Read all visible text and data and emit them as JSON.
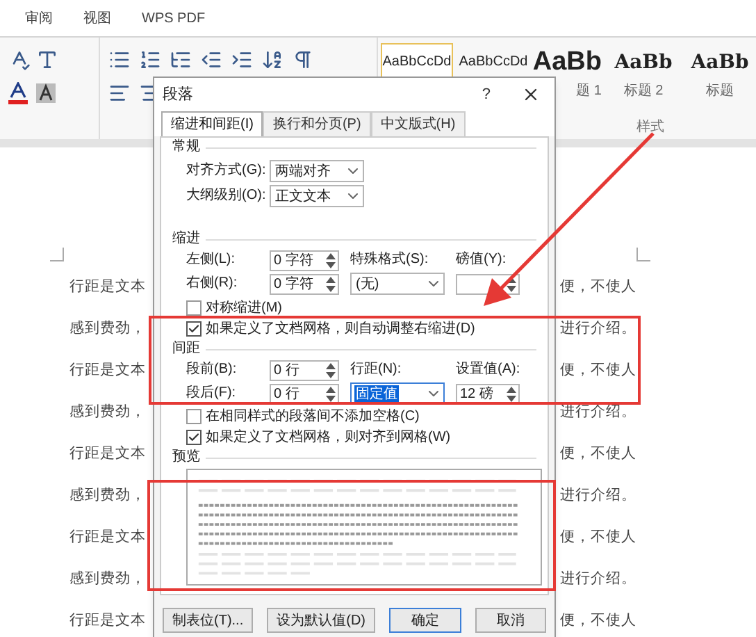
{
  "menu_tabs": [
    {
      "label": "审阅",
      "selected": false
    },
    {
      "label": "视图",
      "selected": false
    },
    {
      "label": "WPS PDF",
      "selected": false
    }
  ],
  "styles_gallery": {
    "group_label": "样式",
    "styles": [
      {
        "preview": "AaBbCcDd",
        "kind": "normal",
        "selected": true
      },
      {
        "preview": "AaBbCcDd",
        "kind": "normal",
        "selected": false
      },
      {
        "preview": "AaBb",
        "label": "题 1",
        "kind": "heading1",
        "selected": false
      },
      {
        "preview": "AaBb",
        "label": "标题 2",
        "kind": "heading2",
        "selected": false
      },
      {
        "preview": "AaBb",
        "label": "标题",
        "kind": "title",
        "selected": false
      }
    ]
  },
  "document": {
    "rows": [
      {
        "left": "行距是文本",
        "right": "便，不使人"
      },
      {
        "left": "感到费劲，",
        "right": "进行介绍。"
      },
      {
        "left": "行距是文本",
        "right": "便，不使人"
      },
      {
        "left": "感到费劲，",
        "right": "进行介绍。"
      },
      {
        "left": "行距是文本",
        "right": "便，不使人"
      },
      {
        "left": "感到费劲，",
        "right": "进行介绍。"
      },
      {
        "left": "行距是文本",
        "right": "便，不使人"
      },
      {
        "left": "感到费劲，",
        "right": "进行介绍。"
      },
      {
        "left": "行距是文本",
        "right": "便，不使人"
      }
    ]
  },
  "dialog": {
    "title": "段落",
    "help": "?",
    "tabs": [
      {
        "label": "缩进和间距(I)",
        "selected": true
      },
      {
        "label": "换行和分页(P)",
        "selected": false
      },
      {
        "label": "中文版式(H)",
        "selected": false
      }
    ],
    "general": {
      "heading": "常规",
      "alignment": {
        "label": "对齐方式(G):",
        "value": "两端对齐"
      },
      "outline_level": {
        "label": "大纲级别(O):",
        "value": "正文文本"
      }
    },
    "indent": {
      "heading": "缩进",
      "left": {
        "label": "左侧(L):",
        "value": "0 字符"
      },
      "right": {
        "label": "右侧(R):",
        "value": "0 字符"
      },
      "special": {
        "label": "特殊格式(S):",
        "value": "(无)"
      },
      "by": {
        "label": "磅值(Y):"
      },
      "checkboxes": [
        {
          "label": "对称缩进(M)",
          "checked": false
        },
        {
          "label": "如果定义了文档网格，则自动调整右缩进(D)",
          "checked": true
        }
      ]
    },
    "spacing": {
      "heading": "间距",
      "before": {
        "label": "段前(B):",
        "value": "0 行"
      },
      "after": {
        "label": "段后(F):",
        "value": "0 行"
      },
      "line_spacing": {
        "label": "行距(N):",
        "value": "固定值",
        "highlighted": true
      },
      "at": {
        "label": "设置值(A):",
        "value": "12 磅"
      },
      "checkboxes": [
        {
          "label": "在相同样式的段落间不添加空格(C)",
          "checked": false
        },
        {
          "label": "如果定义了文档网格，则对齐到网格(W)",
          "checked": true
        }
      ]
    },
    "preview": {
      "heading": "预览"
    },
    "buttons": [
      {
        "label": "制表位(T)...",
        "default": false
      },
      {
        "label": "设为默认值(D)",
        "default": false
      },
      {
        "label": "确定",
        "default": true
      },
      {
        "label": "取消",
        "default": false
      }
    ]
  }
}
